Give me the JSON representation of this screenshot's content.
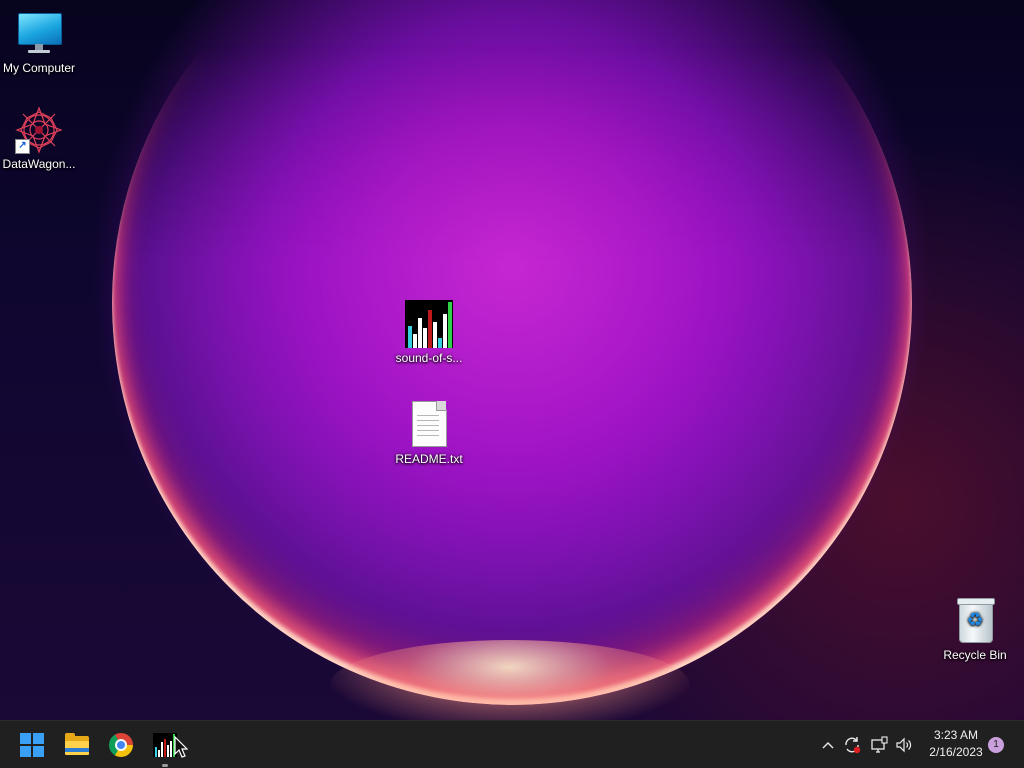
{
  "desktop": {
    "icons": {
      "my_computer": {
        "label": "My Computer",
        "icon": "monitor-icon"
      },
      "datawagon": {
        "label": "DataWagon...",
        "icon": "datawagon-icon",
        "shortcut": true
      },
      "sound_of_sorting": {
        "label": "sound-of-s...",
        "icon": "sound-of-sorting-icon"
      },
      "readme": {
        "label": "README.txt",
        "icon": "text-file-icon"
      },
      "recycle_bin": {
        "label": "Recycle Bin",
        "icon": "recycle-bin-icon"
      }
    }
  },
  "taskbar": {
    "pinned": [
      {
        "name": "start-button",
        "icon": "windows-logo-icon"
      },
      {
        "name": "file-explorer-button",
        "icon": "folder-icon"
      },
      {
        "name": "chrome-button",
        "icon": "chrome-icon"
      },
      {
        "name": "sound-of-sorting-taskbar-button",
        "icon": "sound-of-sorting-icon",
        "running": true
      }
    ],
    "tray": {
      "overflow_icon": "chevron-up-icon",
      "sync_icon": "sync-icon",
      "network_icon": "network-icon",
      "volume_icon": "volume-icon",
      "time": "3:23 AM",
      "date": "2/16/2023",
      "notification_count": "1"
    }
  },
  "colors": {
    "taskbar_bg": "#202020",
    "accent_blue": "#3aa0f5"
  }
}
